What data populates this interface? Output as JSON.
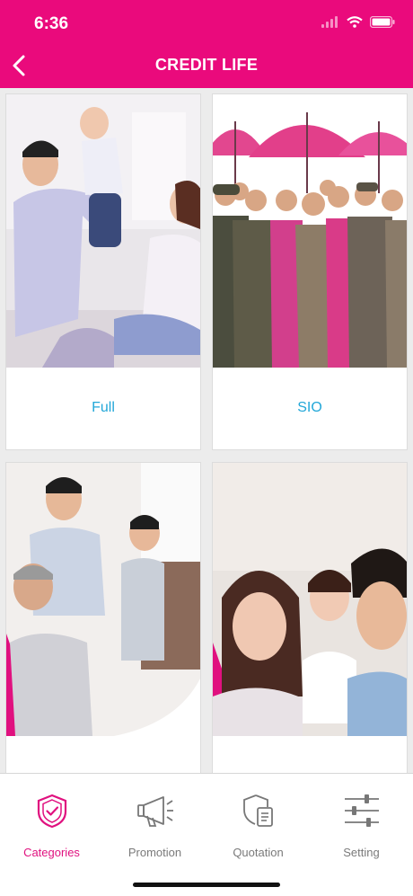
{
  "status_bar": {
    "time": "6:36"
  },
  "header": {
    "title": "CREDIT LIFE"
  },
  "cards": [
    {
      "label": "Full",
      "image": "family-father-lifting-baby-photo"
    },
    {
      "label": "SIO",
      "image": "uniformed-officers-pink-umbrellas-photo"
    },
    {
      "label": "",
      "image": "grandfather-father-son-playing-photo"
    },
    {
      "label": "",
      "image": "smiling-mother-father-daughter-photo"
    }
  ],
  "tabs": [
    {
      "label": "Categories",
      "icon": "shield-check-icon",
      "active": true
    },
    {
      "label": "Promotion",
      "icon": "megaphone-icon",
      "active": false
    },
    {
      "label": "Quotation",
      "icon": "shield-document-icon",
      "active": false
    },
    {
      "label": "Setting",
      "icon": "sliders-icon",
      "active": false
    }
  ],
  "colors": {
    "brand": "#ea0a7c",
    "active_tab": "#e0117f",
    "card_label": "#22a7d8"
  }
}
